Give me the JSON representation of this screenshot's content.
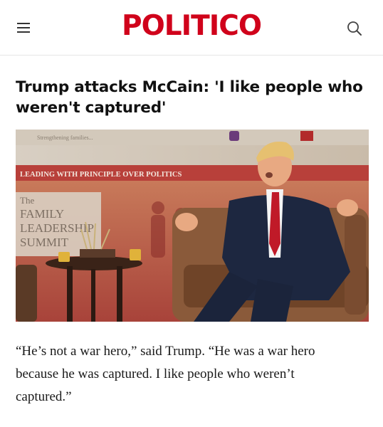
{
  "header": {
    "logo": "POLITICO",
    "menu_icon": "hamburger-menu-icon",
    "search_icon": "search-icon",
    "brand_color": "#d0021b"
  },
  "article": {
    "headline_line1": "Trump attacks McCain: 'I like people who",
    "headline_line2": "weren't captured'",
    "photo": {
      "banner_text": "Strengthening families...",
      "stage_text": "LEADING WITH PRINCIPLE OVER POLITICS",
      "sign_line1": "The",
      "sign_line2": "FAMILY",
      "sign_line3": "LEADERSHIP",
      "sign_line4": "SUMMIT"
    },
    "quote_line1": "“He’s not a war hero,” said Trump. “He was a war hero",
    "quote_line2": "because he was captured. I like people who weren’t",
    "quote_line3": "captured.”"
  }
}
